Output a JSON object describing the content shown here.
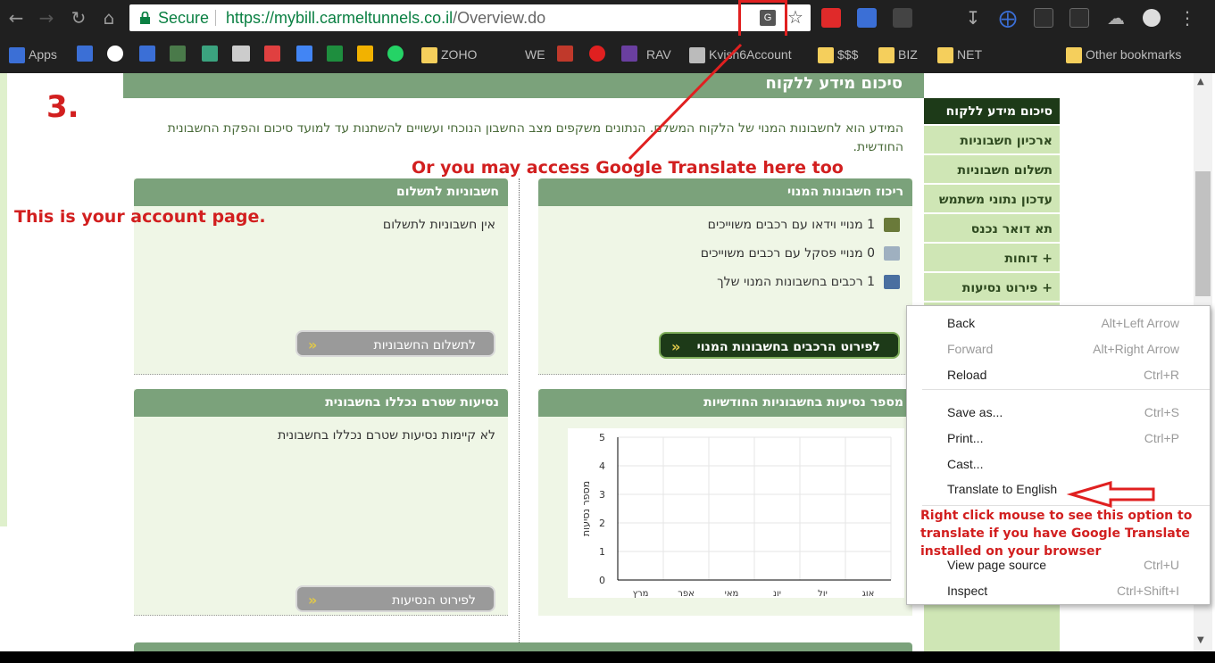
{
  "browser": {
    "secure_label": "Secure",
    "url_host": "https://mybill.carmeltunnels.co.il",
    "url_path": "/Overview.do"
  },
  "bookmarks": [
    "Apps",
    "ZOHO",
    "WE",
    "RAV",
    "Kvish6Account",
    "$$$",
    "BIZ",
    "NET",
    "Other bookmarks"
  ],
  "page": {
    "title": "סיכום מידע ללקוח",
    "intro": "המידע הוא לחשבונות המנוי של הלקוח המשלם. הנתונים משקפים מצב החשבון הנוכחי ועשויים להשתנות עד למועד סיכום והפקת החשבונית החודשית.",
    "panels": {
      "summary": {
        "title": "ריכוז חשבונות המנוי",
        "rows": [
          "1 מנויי וידאו עם רכבים משוייכים",
          "0 מנויי פסקל עם רכבים משוייכים",
          "1 רכבים בחשבונות המנוי שלך"
        ],
        "button": "לפירוט הרכבים בחשבונות המנוי"
      },
      "invoices_due": {
        "title": "חשבוניות לתשלום",
        "text": "אין חשבוניות לתשלום",
        "button": "לתשלום החשבוניות"
      },
      "monthly_trips": {
        "title": "מספר נסיעות בחשבוניות החודשיות"
      },
      "unbilled_trips": {
        "title": "נסיעות שטרם נכללו בחשבונית",
        "text": "לא קיימות נסיעות שטרם נכללו בחשבונית",
        "button": "לפירוט הנסיעות"
      }
    },
    "nav": [
      "סיכום מידע ללקוח",
      "ארכיון חשבוניות",
      "תשלום חשבוניות",
      "עדכון נתוני משתמש",
      "תא דואר נכנס",
      "+ דוחות",
      "+ פירוט נסיעות"
    ]
  },
  "chart_data": {
    "type": "bar",
    "categories": [
      "מרץ",
      "אפר",
      "מאי",
      "יונ",
      "יול",
      "אוג"
    ],
    "values": [
      0,
      0,
      0,
      0,
      0,
      0
    ],
    "ylabel": "מספר נסיעות",
    "ylim": [
      0,
      5
    ],
    "yticks": [
      "0",
      "1",
      "2",
      "3",
      "4",
      "5"
    ],
    "grid": true
  },
  "context_menu": [
    {
      "label": "Back",
      "key": "Alt+Left Arrow",
      "disabled": false
    },
    {
      "label": "Forward",
      "key": "Alt+Right Arrow",
      "disabled": true
    },
    {
      "label": "Reload",
      "key": "Ctrl+R",
      "disabled": false
    },
    {
      "label": "Save as...",
      "key": "Ctrl+S",
      "disabled": false
    },
    {
      "label": "Print...",
      "key": "Ctrl+P",
      "disabled": false
    },
    {
      "label": "Cast...",
      "key": "",
      "disabled": false
    },
    {
      "label": "Translate to English",
      "key": "",
      "disabled": false
    },
    {
      "label": "View page source",
      "key": "Ctrl+U",
      "disabled": false
    },
    {
      "label": "Inspect",
      "key": "Ctrl+Shift+I",
      "disabled": false
    }
  ],
  "annotations": {
    "step": "3.",
    "account": "This is your account page.",
    "translate_here": "Or you may access Google Translate here too",
    "right_click_1": "Right click mouse to see this option to",
    "right_click_2": "translate if you have Google Translate",
    "right_click_3": "installed on your browser"
  },
  "colors": {
    "accent_green": "#7ba27b",
    "dark_green": "#1d3a18",
    "annotation_red": "#d21f1f"
  }
}
